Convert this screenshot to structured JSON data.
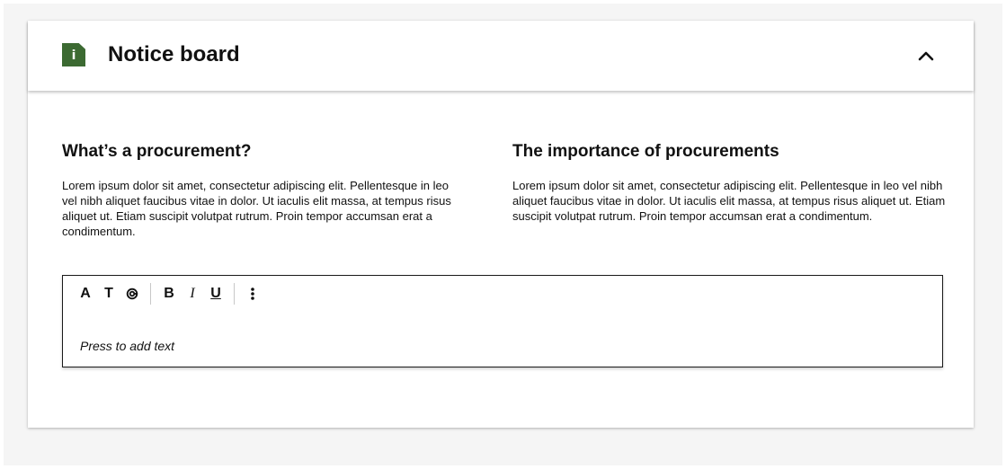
{
  "notice_board": {
    "title": "Notice board",
    "badge_glyph": "i",
    "badge_color": "#3c6a32",
    "collapse_icon": "chevron-up-icon"
  },
  "columns": [
    {
      "heading": "What’s a procurement?",
      "body": "Lorem ipsum dolor sit amet, consectetur adipiscing elit. Pellentesque in leo vel nibh aliquet faucibus vitae in dolor. Ut iaculis elit massa, at tempus risus aliquet ut. Etiam suscipit volutpat rutrum. Proin tempor accumsan erat a condimentum."
    },
    {
      "heading": "The importance of procurements",
      "body": "Lorem ipsum dolor sit amet, consectetur adipiscing elit. Pellentesque in leo vel nibh aliquet faucibus vitae in dolor. Ut iaculis elit massa, at tempus risus aliquet ut. Etiam suscipit volutpat rutrum. Proin tempor accumsan erat a condimentum."
    }
  ],
  "editor": {
    "toolbar": {
      "font_size": "A",
      "text_style": "T",
      "bold": "B",
      "italic": "I",
      "underline": "U"
    },
    "placeholder": "Press to add text"
  }
}
